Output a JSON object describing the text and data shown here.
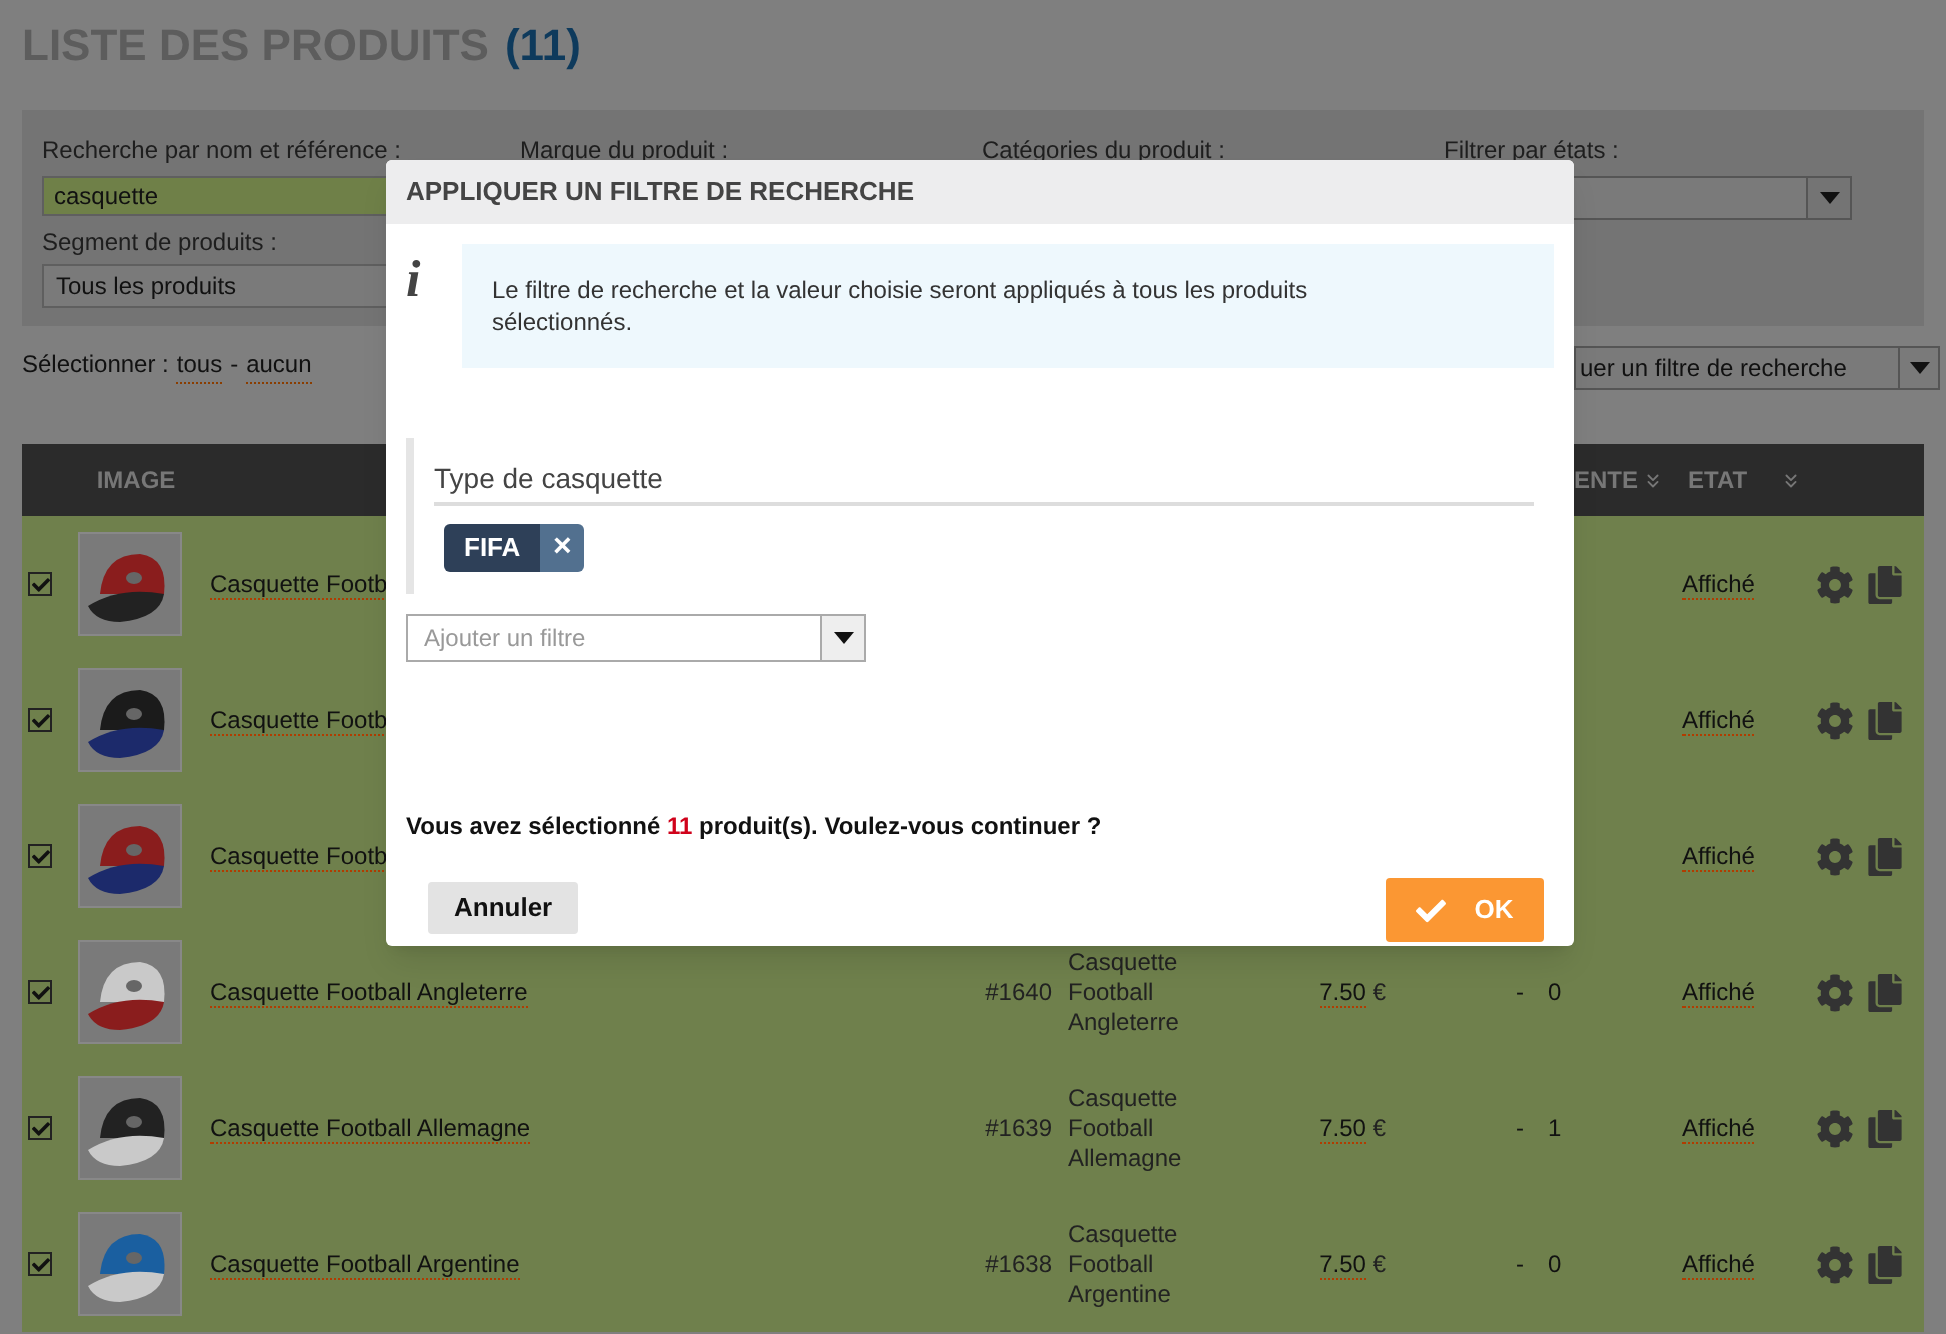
{
  "page": {
    "title": "LISTE DES PRODUITS",
    "count": "(11)"
  },
  "filters": {
    "search_label": "Recherche par nom et référence :",
    "search_value": "casquette",
    "brand_label": "Marque du produit :",
    "category_label": "Catégories du produit :",
    "state_label": "Filtrer par états :",
    "segment_label": "Segment de produits :",
    "segment_value": "Tous les produits"
  },
  "selection": {
    "label": "Sélectionner :",
    "all": "tous",
    "separator": "-",
    "none": "aucun",
    "action_select": "uer un filtre de recherche"
  },
  "table": {
    "columns": [
      "IMAGE",
      "ENTE",
      "ETAT"
    ],
    "rows": [
      {
        "checked": true,
        "name": "Casquette Footb",
        "state": "Affiché"
      },
      {
        "checked": true,
        "name": "Casquette Footb",
        "state": "Affiché"
      },
      {
        "checked": true,
        "name": "Casquette Footb",
        "state": "Affiché"
      },
      {
        "checked": true,
        "name": "Casquette Football Angleterre",
        "ref": "#1640",
        "description": "Casquette Football Angleterre",
        "price": "7.50",
        "currency": "€",
        "dash": "-",
        "quantity": "0",
        "state": "Affiché"
      },
      {
        "checked": true,
        "name": "Casquette Football Allemagne",
        "ref": "#1639",
        "description": "Casquette Football Allemagne",
        "price": "7.50",
        "currency": "€",
        "dash": "-",
        "quantity": "1",
        "state": "Affiché"
      },
      {
        "checked": true,
        "name": "Casquette Football Argentine",
        "ref": "#1638",
        "description": "Casquette Football Argentine",
        "price": "7.50",
        "currency": "€",
        "dash": "-",
        "quantity": "0",
        "state": "Affiché"
      }
    ]
  },
  "dialog": {
    "title": "APPLIQUER UN FILTRE DE RECHERCHE",
    "info_icon": "i",
    "info": "Le filtre de recherche et la valeur choisie seront appliqués à tous les produits sélectionnés.",
    "filter_label": "Type de casquette",
    "tags": [
      {
        "label": "FIFA",
        "remove": "×"
      }
    ],
    "add_filter_placeholder": "Ajouter un filtre",
    "message_before": "Vous avez sélectionné",
    "message_count": "11",
    "message_after": "produit(s). Voulez-vous continuer ?",
    "cancel": "Annuler",
    "ok": "OK"
  }
}
